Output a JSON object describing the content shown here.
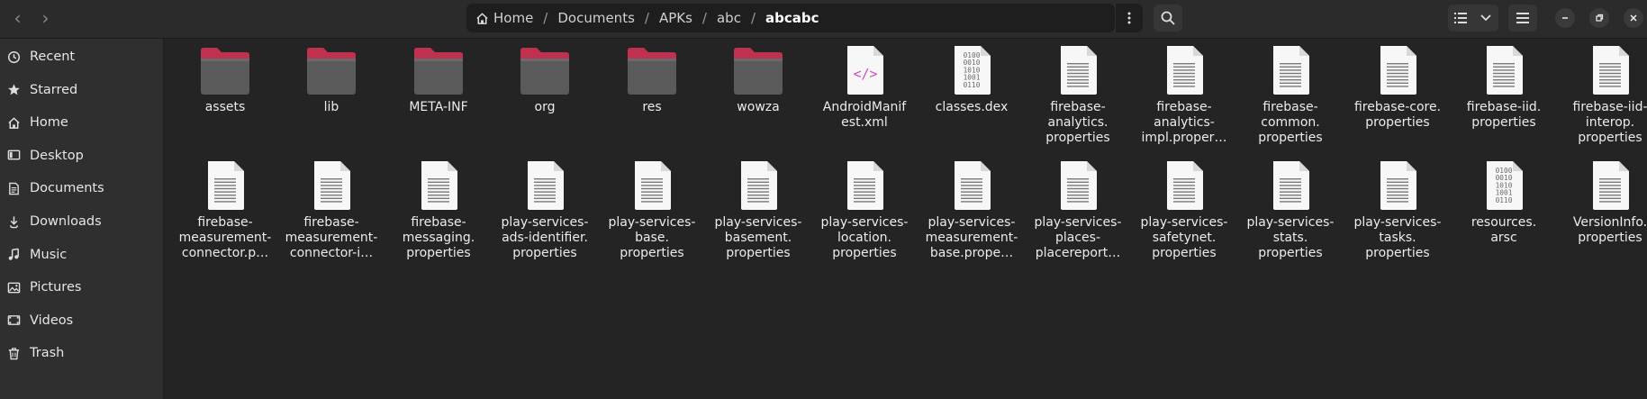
{
  "header": {
    "breadcrumbs": [
      {
        "label": "Home",
        "icon": "home-icon"
      },
      {
        "label": "Documents"
      },
      {
        "label": "APKs"
      },
      {
        "label": "abc"
      },
      {
        "label": "abcabc",
        "current": true
      }
    ],
    "separator": "/",
    "nav_back": "‹",
    "nav_forward": "›"
  },
  "sidebar": {
    "items": [
      {
        "label": "Recent",
        "icon": "clock-icon"
      },
      {
        "label": "Starred",
        "icon": "star-icon"
      },
      {
        "label": "Home",
        "icon": "home-icon"
      },
      {
        "label": "Desktop",
        "icon": "desktop-icon"
      },
      {
        "label": "Documents",
        "icon": "document-icon"
      },
      {
        "label": "Downloads",
        "icon": "download-icon"
      },
      {
        "label": "Music",
        "icon": "music-icon"
      },
      {
        "label": "Pictures",
        "icon": "picture-icon"
      },
      {
        "label": "Videos",
        "icon": "video-icon"
      },
      {
        "label": "Trash",
        "icon": "trash-icon"
      }
    ]
  },
  "files": [
    {
      "label": "assets",
      "type": "folder"
    },
    {
      "label": "lib",
      "type": "folder"
    },
    {
      "label": "META-INF",
      "type": "folder"
    },
    {
      "label": "org",
      "type": "folder"
    },
    {
      "label": "res",
      "type": "folder"
    },
    {
      "label": "wowza",
      "type": "folder"
    },
    {
      "label": "AndroidManif\nest.xml",
      "type": "xml"
    },
    {
      "label": "classes.dex",
      "type": "binary"
    },
    {
      "label": "firebase-\nanalytics.\nproperties",
      "type": "text"
    },
    {
      "label": "firebase-\nanalytics-\nimpl.proper…",
      "type": "text"
    },
    {
      "label": "firebase-\ncommon.\nproperties",
      "type": "text"
    },
    {
      "label": "firebase-core.\nproperties",
      "type": "text"
    },
    {
      "label": "firebase-iid.\nproperties",
      "type": "text"
    },
    {
      "label": "firebase-iid-\ninterop.\nproperties",
      "type": "text"
    },
    {
      "label": "firebase-\nmeasurement-\nconnector.p…",
      "type": "text"
    },
    {
      "label": "firebase-\nmeasurement-\nconnector-i…",
      "type": "text"
    },
    {
      "label": "firebase-\nmessaging.\nproperties",
      "type": "text"
    },
    {
      "label": "play-services-\nads-identifier.\nproperties",
      "type": "text"
    },
    {
      "label": "play-services-\nbase.\nproperties",
      "type": "text"
    },
    {
      "label": "play-services-\nbasement.\nproperties",
      "type": "text"
    },
    {
      "label": "play-services-\nlocation.\nproperties",
      "type": "text"
    },
    {
      "label": "play-services-\nmeasurement-\nbase.prope…",
      "type": "text"
    },
    {
      "label": "play-services-\nplaces-\nplacereport…",
      "type": "text"
    },
    {
      "label": "play-services-\nsafetynet.\nproperties",
      "type": "text"
    },
    {
      "label": "play-services-\nstats.\nproperties",
      "type": "text"
    },
    {
      "label": "play-services-\ntasks.\nproperties",
      "type": "text"
    },
    {
      "label": "resources.\narsc",
      "type": "binary"
    },
    {
      "label": "VersionInfo.\nproperties",
      "type": "text"
    }
  ],
  "binary_glyph": "0100\n0010\n1010\n1001\n0110",
  "xml_glyph": "</>",
  "colors": {
    "folder_tab": "#c0304f",
    "folder_body": "#5a5a5a",
    "xml_accent": "#d04fbf",
    "background": "#242424",
    "sidebar": "#2f2f2f"
  }
}
